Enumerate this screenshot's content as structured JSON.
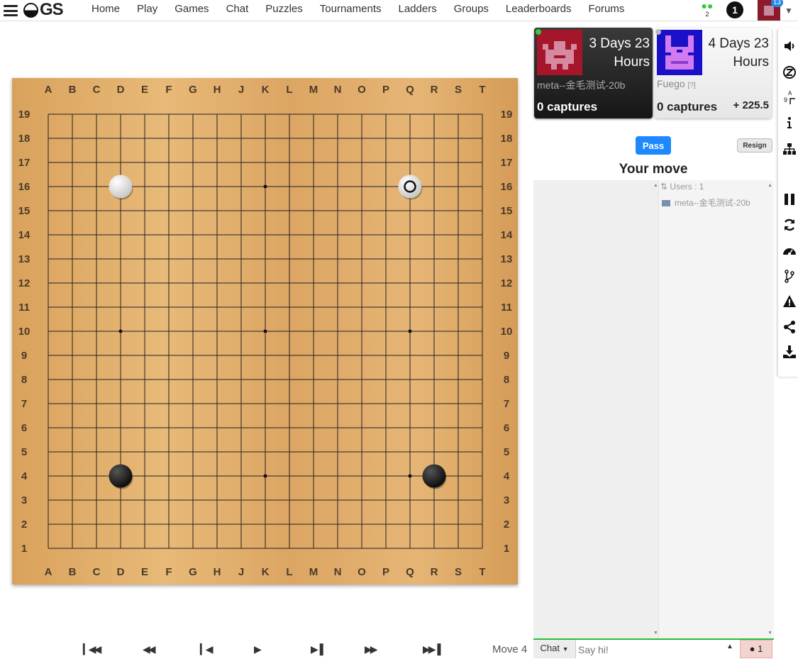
{
  "nav": {
    "logo_text": "GS",
    "links": [
      "Home",
      "Play",
      "Games",
      "Chat",
      "Puzzles",
      "Tournaments",
      "Ladders",
      "Groups",
      "Leaderboards",
      "Forums"
    ],
    "friends_count": "2",
    "notifications_count": "1",
    "user_badge": "13"
  },
  "board": {
    "size": 19,
    "columns": [
      "A",
      "B",
      "C",
      "D",
      "E",
      "F",
      "G",
      "H",
      "J",
      "K",
      "L",
      "M",
      "N",
      "O",
      "P",
      "Q",
      "R",
      "S",
      "T"
    ],
    "stones": [
      {
        "color": "white",
        "pos": "D16"
      },
      {
        "color": "white",
        "pos": "Q16",
        "last_move": true
      },
      {
        "color": "black",
        "pos": "D4"
      },
      {
        "color": "black",
        "pos": "R4"
      }
    ],
    "star_points": [
      "D4",
      "K4",
      "Q4",
      "D10",
      "K10",
      "Q10",
      "D16",
      "K16",
      "Q16"
    ],
    "wood_color": "#dea96a"
  },
  "players": {
    "black": {
      "clock_line1": "3 Days 23",
      "clock_line2": "Hours",
      "name": "meta--金毛测试-20b",
      "captures": "0 captures",
      "online": true,
      "avatar_color": "#a5162a"
    },
    "white": {
      "clock_line1": "4 Days 23",
      "clock_line2": "Hours",
      "name": "Fuego",
      "rank_hint": "[?]",
      "captures": "0 captures",
      "score": "+ 225.5",
      "avatar_color": "#1a10c8"
    }
  },
  "controls": {
    "pass_label": "Pass",
    "resign_label": "Resign",
    "status": "Your move"
  },
  "chat": {
    "users_header": "Users : 1",
    "users": [
      "meta--金毛测试-20b"
    ],
    "channel_label": "Chat",
    "input_placeholder": "Say hi!",
    "users_button_count": "1"
  },
  "playback": {
    "move_label": "Move 4"
  },
  "colors": {
    "accent": "#1e88ff",
    "online": "#2ecc40",
    "chat_bar": "#2bbd3a"
  }
}
